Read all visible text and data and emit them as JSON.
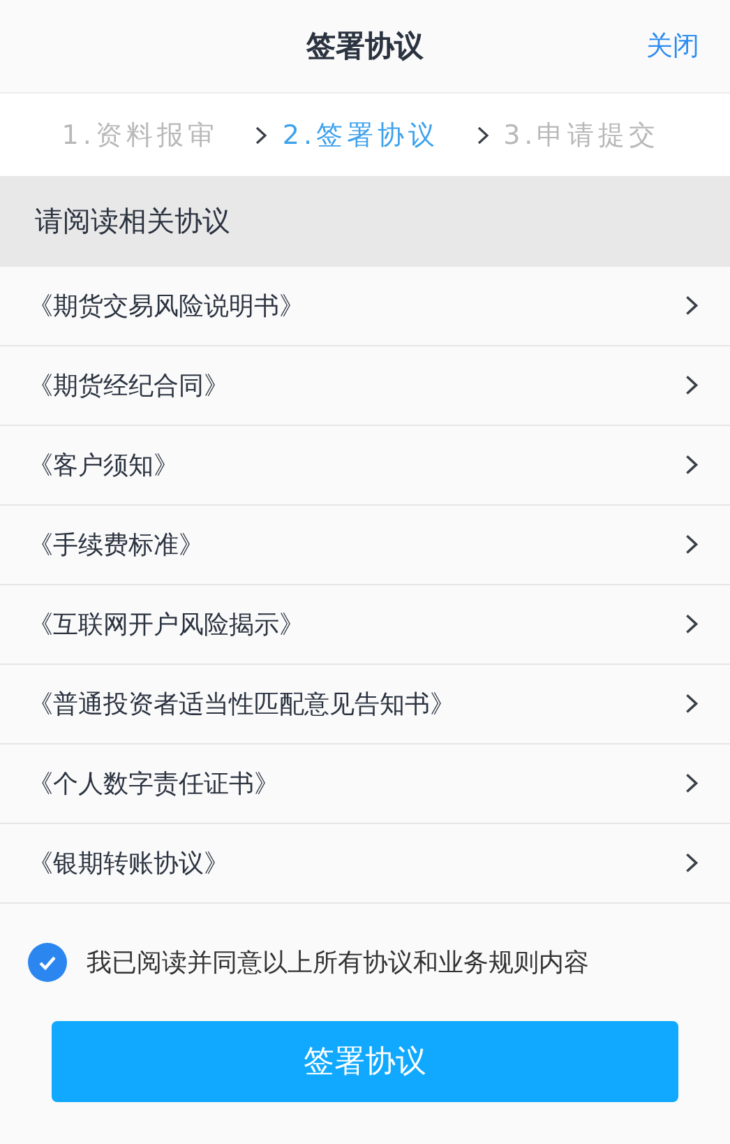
{
  "header": {
    "title": "签署协议",
    "close": "关闭"
  },
  "steps": [
    {
      "label": "1.资料报审",
      "selected": false
    },
    {
      "label": "2.签署协议",
      "selected": true
    },
    {
      "label": "3.申请提交",
      "selected": false
    }
  ],
  "section": {
    "title": "请阅读相关协议"
  },
  "agreements": [
    "《期货交易风险说明书》",
    "《期货经纪合同》",
    "《客户须知》",
    "《手续费标准》",
    "《互联网开户风险揭示》",
    "《普通投资者适当性匹配意见告知书》",
    "《个人数字责任证书》",
    "《银期转账协议》"
  ],
  "consent": {
    "label": "我已阅读并同意以上所有协议和业务规则内容",
    "checked": true
  },
  "submit": "签署协议"
}
